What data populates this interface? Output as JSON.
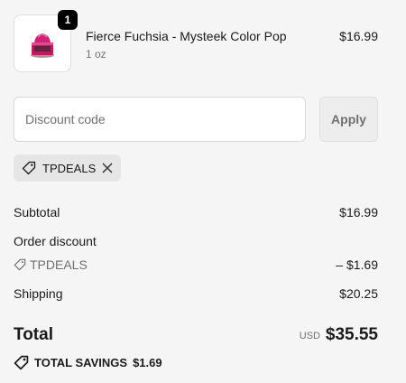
{
  "product": {
    "quantity": "1",
    "title": "Fierce Fuchsia - Mysteek Color Pop",
    "variant": "1 oz",
    "price": "$16.99",
    "image": "fuchsia-hair-color-jar"
  },
  "discount": {
    "placeholder": "Discount code",
    "apply_label": "Apply",
    "applied_code": "TPDEALS"
  },
  "summary": {
    "subtotal_label": "Subtotal",
    "subtotal_value": "$16.99",
    "order_discount_label": "Order discount",
    "discount_code": "TPDEALS",
    "discount_value": "– $1.69",
    "shipping_label": "Shipping",
    "shipping_value": "$20.25",
    "total_label": "Total",
    "currency": "USD",
    "total_value": "$35.55",
    "savings_label": "TOTAL SAVINGS",
    "savings_value": "$1.69"
  },
  "colors": {
    "accent": "#1a1a1a",
    "product_color": "#d21f77"
  },
  "icons": [
    "tag-icon",
    "close-icon"
  ]
}
